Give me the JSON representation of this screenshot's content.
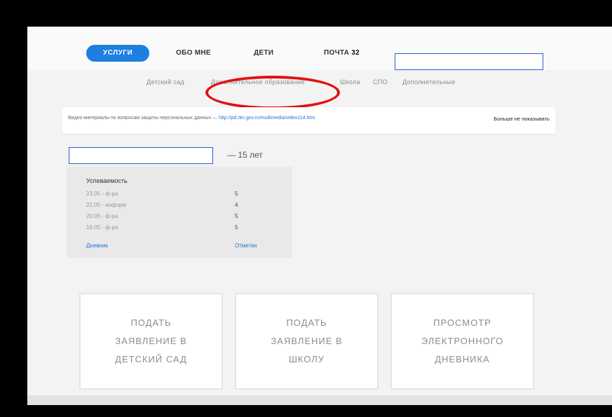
{
  "nav": {
    "items": [
      {
        "label": "УСЛУГИ",
        "active": true
      },
      {
        "label": "ОБО МНЕ"
      },
      {
        "label": "ДЕТИ"
      },
      {
        "label": "ПОЧТА",
        "count": "32"
      }
    ]
  },
  "subnav": {
    "items": [
      "Детский сад",
      "Дополнительное образование",
      "Школа",
      "СПО",
      "Дополнительные"
    ]
  },
  "banner": {
    "text": "Видео-материалы по вопросам защиты персональных данных — ",
    "link": "http://pd.rkn.gov.ru/multimedia/video114.htm",
    "dismiss": "Больше не показывать"
  },
  "child": {
    "age": "— 15 лет"
  },
  "performance": {
    "title": "Успеваемость",
    "rows": [
      {
        "label": "23.05 - ф-ра",
        "grade": "5"
      },
      {
        "label": "22.05 - информ",
        "grade": "4"
      },
      {
        "label": "20.05 - ф-ра",
        "grade": "5"
      },
      {
        "label": "16.05 - ф-ра",
        "grade": "5"
      }
    ],
    "diary_link": "Дневник",
    "marks_link": "Отметки"
  },
  "tiles": [
    {
      "label": "ПОДАТЬ ЗАЯВЛЕНИЕ В ДЕТСКИЙ САД"
    },
    {
      "label": "ПОДАТЬ ЗАЯВЛЕНИЕ В ШКОЛУ"
    },
    {
      "label": "ПРОСМОТР ЭЛЕКТРОННОГО ДНЕВНИКА"
    }
  ],
  "colors": {
    "accent": "#1d7fe0",
    "highlight": "#e31010",
    "redaction": "#2b5fd0"
  }
}
